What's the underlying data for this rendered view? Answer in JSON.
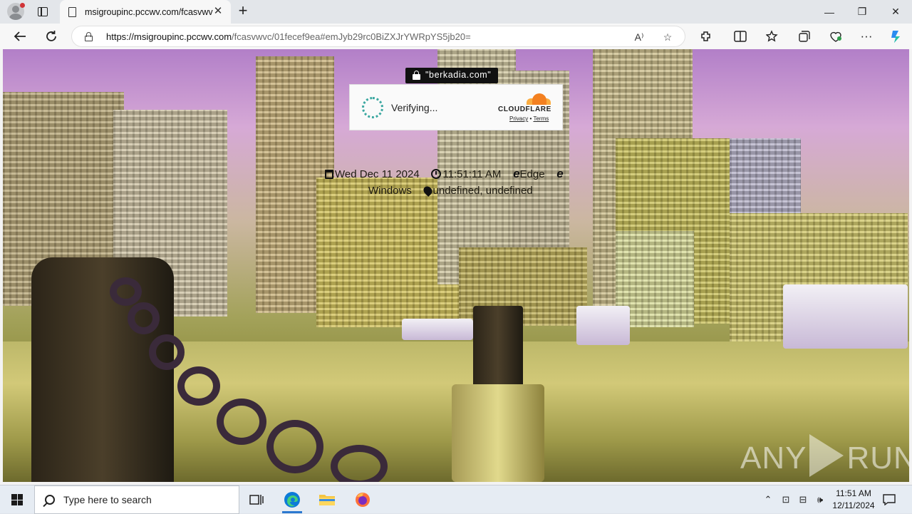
{
  "browser": {
    "tab_title": "msigroupinc.pccwv.com/fcasvwvc",
    "new_tab_symbol": "+",
    "tab_close_symbol": "✕",
    "url_host": "https://msigroupinc.pccwv.com",
    "url_path": "/fcasvwvc/01fecef9ea#emJyb29rc0BiZXJrYWRpYS5jb20=",
    "window_controls": {
      "minimize": "—",
      "restore": "❐",
      "close": "✕"
    }
  },
  "page": {
    "domain_pill": "\"berkadia.com\"",
    "captcha": {
      "status": "Verifying...",
      "brand": "CLOUDFLARE",
      "privacy": "Privacy",
      "separator": " • ",
      "terms": "Terms"
    },
    "info": {
      "date": "Wed Dec 11 2024",
      "time": "11:51:11 AM",
      "browser": "Edge",
      "os": "Windows",
      "location": "undefined, undefined"
    },
    "watermark": {
      "left": "ANY",
      "right": "RUN"
    }
  },
  "taskbar": {
    "search_placeholder": "Type here to search",
    "time": "11:51 AM",
    "date": "12/11/2024"
  },
  "colors": {
    "cloudflare_orange": "#f38020",
    "cloudflare_light": "#fbad41",
    "spinner": "#3aa7a0",
    "edge_blue": "#0c7bd8"
  }
}
